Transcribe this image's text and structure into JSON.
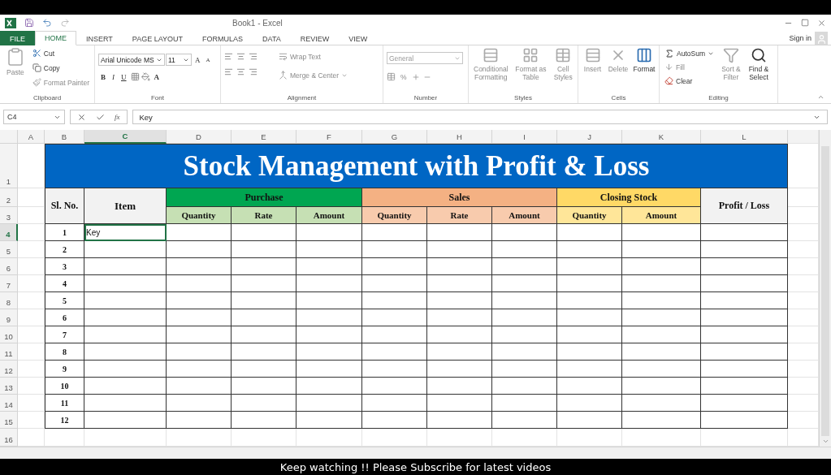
{
  "title_bar": {
    "title": "Book1 - Excel"
  },
  "ribbon_tabs": [
    {
      "label": "FILE",
      "kind": "file",
      "selected": false
    },
    {
      "label": "HOME",
      "kind": "tab",
      "selected": true
    },
    {
      "label": "INSERT",
      "kind": "tab",
      "selected": false
    },
    {
      "label": "PAGE LAYOUT",
      "kind": "tab",
      "selected": false
    },
    {
      "label": "FORMULAS",
      "kind": "tab",
      "selected": false
    },
    {
      "label": "DATA",
      "kind": "tab",
      "selected": false
    },
    {
      "label": "REVIEW",
      "kind": "tab",
      "selected": false
    },
    {
      "label": "VIEW",
      "kind": "tab",
      "selected": false
    }
  ],
  "account": {
    "label": "Sign in"
  },
  "ribbon": {
    "clipboard": {
      "label": "Clipboard",
      "paste": "Paste",
      "cut": "Cut",
      "copy": "Copy",
      "format_painter": "Format Painter"
    },
    "font": {
      "label": "Font",
      "font_name": "Arial Unicode MS",
      "font_size": "11",
      "grow": "A",
      "shrink": "A",
      "bold": "B",
      "italic": "I",
      "underline": "U",
      "font_color": "A"
    },
    "alignment": {
      "label": "Alignment",
      "wrap_text": "Wrap Text",
      "merge": "Merge & Center"
    },
    "number": {
      "label": "Number",
      "format": "General",
      "percent": "%"
    },
    "styles": {
      "label": "Styles",
      "items": [
        "Conditional Formatting",
        "Format as Table",
        "Cell Styles"
      ]
    },
    "cells": {
      "label": "Cells",
      "items": [
        "Insert",
        "Delete",
        "Format"
      ]
    },
    "editing": {
      "label": "Editing",
      "autosum": "AutoSum",
      "fill": "Fill",
      "clear": "Clear",
      "sort": "Sort & Filter",
      "find": "Find & Select"
    }
  },
  "formula_bar": {
    "name_box": "C4",
    "function_label": "fx",
    "value": "Key"
  },
  "columns": [
    {
      "label": "A",
      "selected": false
    },
    {
      "label": "B",
      "selected": false
    },
    {
      "label": "C",
      "selected": true
    },
    {
      "label": "D",
      "selected": false
    },
    {
      "label": "E",
      "selected": false
    },
    {
      "label": "F",
      "selected": false
    },
    {
      "label": "G",
      "selected": false
    },
    {
      "label": "H",
      "selected": false
    },
    {
      "label": "I",
      "selected": false
    },
    {
      "label": "J",
      "selected": false
    },
    {
      "label": "K",
      "selected": false
    },
    {
      "label": "L",
      "selected": false
    }
  ],
  "row_numbers": [
    {
      "label": "1",
      "selected": false
    },
    {
      "label": "2",
      "selected": false
    },
    {
      "label": "3",
      "selected": false
    },
    {
      "label": "4",
      "selected": true
    },
    {
      "label": "5",
      "selected": false
    },
    {
      "label": "6",
      "selected": false
    },
    {
      "label": "7",
      "selected": false
    },
    {
      "label": "8",
      "selected": false
    },
    {
      "label": "9",
      "selected": false
    },
    {
      "label": "10",
      "selected": false
    },
    {
      "label": "11",
      "selected": false
    },
    {
      "label": "12",
      "selected": false
    },
    {
      "label": "13",
      "selected": false
    },
    {
      "label": "14",
      "selected": false
    },
    {
      "label": "15",
      "selected": false
    },
    {
      "label": "16",
      "selected": false
    }
  ],
  "table": {
    "title": "Stock Management with Profit & Loss",
    "sl_header": "Sl. No.",
    "item_header": "Item",
    "result_header": "Profit / Loss",
    "groups": [
      {
        "label": "Purchase",
        "color": "#00a651",
        "subs": [
          {
            "label": "Quantity",
            "color": "#c6e0b4"
          },
          {
            "label": "Rate",
            "color": "#c6e0b4"
          },
          {
            "label": "Amount",
            "color": "#c6e0b4"
          }
        ]
      },
      {
        "label": "Sales",
        "color": "#f4b183",
        "subs": [
          {
            "label": "Quantity",
            "color": "#f8cbad"
          },
          {
            "label": "Rate",
            "color": "#f8cbad"
          },
          {
            "label": "Amount",
            "color": "#f8cbad"
          }
        ]
      },
      {
        "label": "Closing Stock",
        "color": "#ffd966",
        "subs": [
          {
            "label": "Quantity",
            "color": "#ffe699"
          },
          {
            "label": "Amount",
            "color": "#ffe699"
          }
        ]
      }
    ],
    "rows": [
      {
        "sl": "1",
        "item": "Key",
        "selected": true
      },
      {
        "sl": "2",
        "selected": false
      },
      {
        "sl": "3",
        "selected": false
      },
      {
        "sl": "4",
        "selected": false
      },
      {
        "sl": "5",
        "selected": false
      },
      {
        "sl": "6",
        "selected": false
      },
      {
        "sl": "7",
        "selected": false
      },
      {
        "sl": "8",
        "selected": false
      },
      {
        "sl": "9",
        "selected": false
      },
      {
        "sl": "10",
        "selected": false
      },
      {
        "sl": "11",
        "selected": false
      },
      {
        "sl": "12",
        "selected": false
      }
    ]
  },
  "caption": "Keep watching !! Please Subscribe for latest videos"
}
